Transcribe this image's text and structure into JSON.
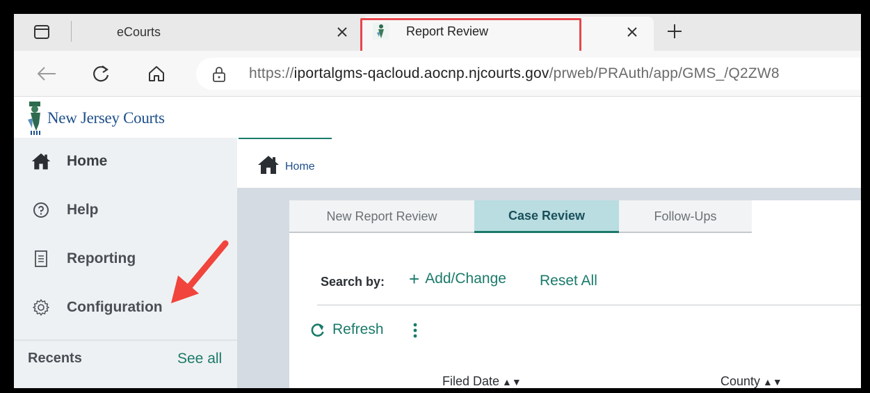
{
  "browser": {
    "tabs": [
      {
        "title": "eCourts",
        "active": false
      },
      {
        "title": "Report Review",
        "active": true
      }
    ],
    "url": {
      "prefix": "https://",
      "domain": "iportalgms-qacloud.aocnp.njcourts.gov",
      "path": "/prweb/PRAuth/app/GMS_/Q2ZW8"
    },
    "highlight_color": "#e8464b"
  },
  "site": {
    "brand": "New Jersey Courts",
    "accent": "#1a7a6a"
  },
  "sidebar": {
    "items": [
      {
        "label": "Home",
        "icon": "home-icon"
      },
      {
        "label": "Help",
        "icon": "help-circle-icon"
      },
      {
        "label": "Reporting",
        "icon": "document-icon"
      },
      {
        "label": "Configuration",
        "icon": "gear-icon"
      }
    ],
    "recents_label": "Recents",
    "see_all": "See all",
    "annotation_arrow_color": "#f0443c"
  },
  "main": {
    "breadcrumb_tab": "Home",
    "subtabs": [
      "New Report Review",
      "Case Review",
      "Follow-Ups"
    ],
    "active_subtab": "Case Review",
    "search_by_label": "Search by:",
    "add_change": "Add/Change",
    "reset_all": "Reset All",
    "refresh": "Refresh",
    "columns": [
      "Filed Date",
      "County"
    ]
  }
}
